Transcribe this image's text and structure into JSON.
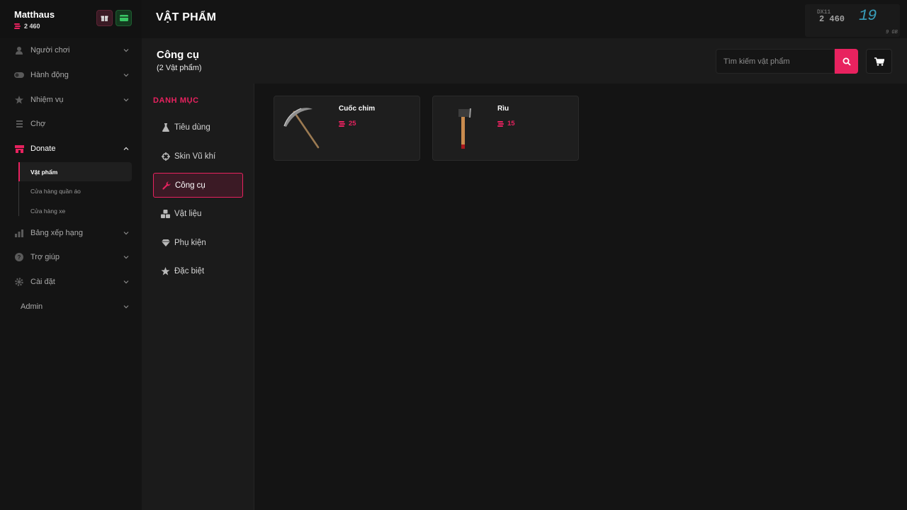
{
  "user": {
    "name": "Matthaus",
    "balance": "2 460"
  },
  "sidebar": {
    "items": [
      {
        "label": "Người chơi",
        "icon": "user-icon"
      },
      {
        "label": "Hành động",
        "icon": "toggle-icon"
      },
      {
        "label": "Nhiệm vụ",
        "icon": "star-icon"
      },
      {
        "label": "Chợ",
        "icon": "list-icon"
      },
      {
        "label": "Donate",
        "icon": "store-icon"
      },
      {
        "label": "Bảng xếp hạng",
        "icon": "chart-icon"
      },
      {
        "label": "Trợ giúp",
        "icon": "help-icon"
      },
      {
        "label": "Cài đặt",
        "icon": "gear-icon"
      },
      {
        "label": "Admin",
        "icon": ""
      }
    ],
    "donate_sub": [
      "Vật phẩm",
      "Cửa hàng quần áo",
      "Cửa hàng xe"
    ]
  },
  "header": {
    "title": "VẬT PHẨM"
  },
  "overlay": {
    "api": "DX11",
    "number": "2 460",
    "fps": "19",
    "mem": "9 GB"
  },
  "category": {
    "title": "Công cụ",
    "count": "(2 Vật phẩm)",
    "search_placeholder": "Tìm kiếm vật phẩm"
  },
  "categories": {
    "heading": "DANH MỤC",
    "items": [
      {
        "label": "Tiêu dùng",
        "icon": "flask-icon"
      },
      {
        "label": "Skin Vũ khí",
        "icon": "crosshair-icon"
      },
      {
        "label": "Công cụ",
        "icon": "wrench-icon",
        "active": true
      },
      {
        "label": "Vật liệu",
        "icon": "materials-icon"
      },
      {
        "label": "Phụ kiện",
        "icon": "gem-icon"
      },
      {
        "label": "Đặc biệt",
        "icon": "star-icon"
      }
    ]
  },
  "products": [
    {
      "name": "Cuốc chim",
      "price": "25",
      "icon": "pickaxe-icon"
    },
    {
      "name": "Rìu",
      "price": "15",
      "icon": "axe-icon"
    }
  ],
  "colors": {
    "accent": "#e8225f",
    "bg": "#141414",
    "panel": "#1b1b1b",
    "overlay_cyan": "#3fb5d6"
  }
}
